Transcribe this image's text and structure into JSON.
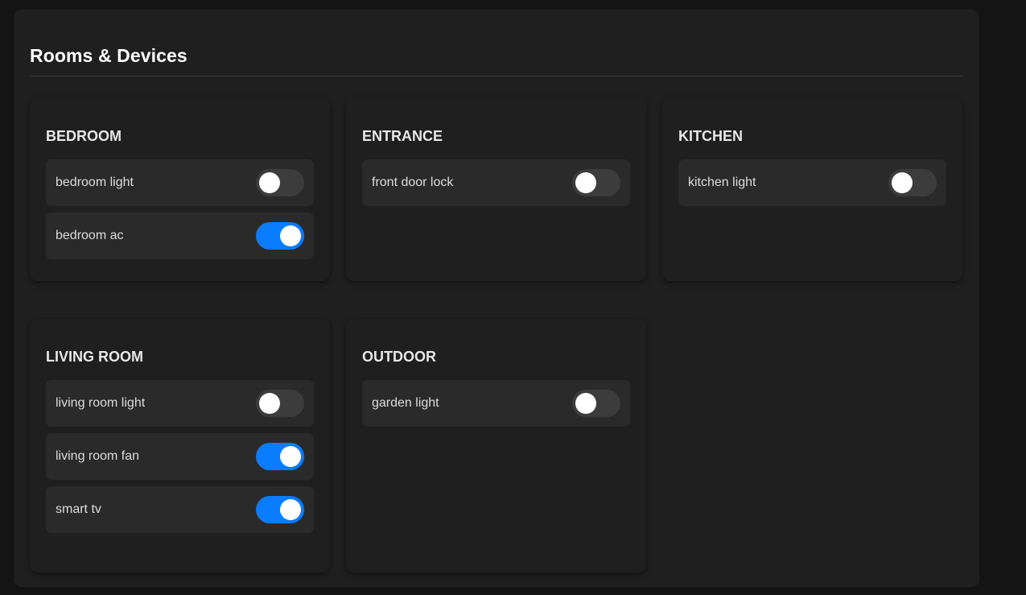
{
  "page": {
    "title": "Rooms & Devices"
  },
  "colors": {
    "toggle_on": "#0a7cff",
    "toggle_off": "#3c3c3c",
    "background": "#141414",
    "panel": "#1f1f1f"
  },
  "rooms": [
    {
      "name": "BEDROOM",
      "devices": [
        {
          "name": "bedroom light",
          "on": false
        },
        {
          "name": "bedroom ac",
          "on": true
        }
      ]
    },
    {
      "name": "ENTRANCE",
      "devices": [
        {
          "name": "front door lock",
          "on": false
        }
      ]
    },
    {
      "name": "KITCHEN",
      "devices": [
        {
          "name": "kitchen light",
          "on": false
        }
      ]
    },
    {
      "name": "LIVING ROOM",
      "devices": [
        {
          "name": "living room light",
          "on": false
        },
        {
          "name": "living room fan",
          "on": true
        },
        {
          "name": "smart tv",
          "on": true
        }
      ]
    },
    {
      "name": "OUTDOOR",
      "devices": [
        {
          "name": "garden light",
          "on": false
        }
      ]
    }
  ]
}
